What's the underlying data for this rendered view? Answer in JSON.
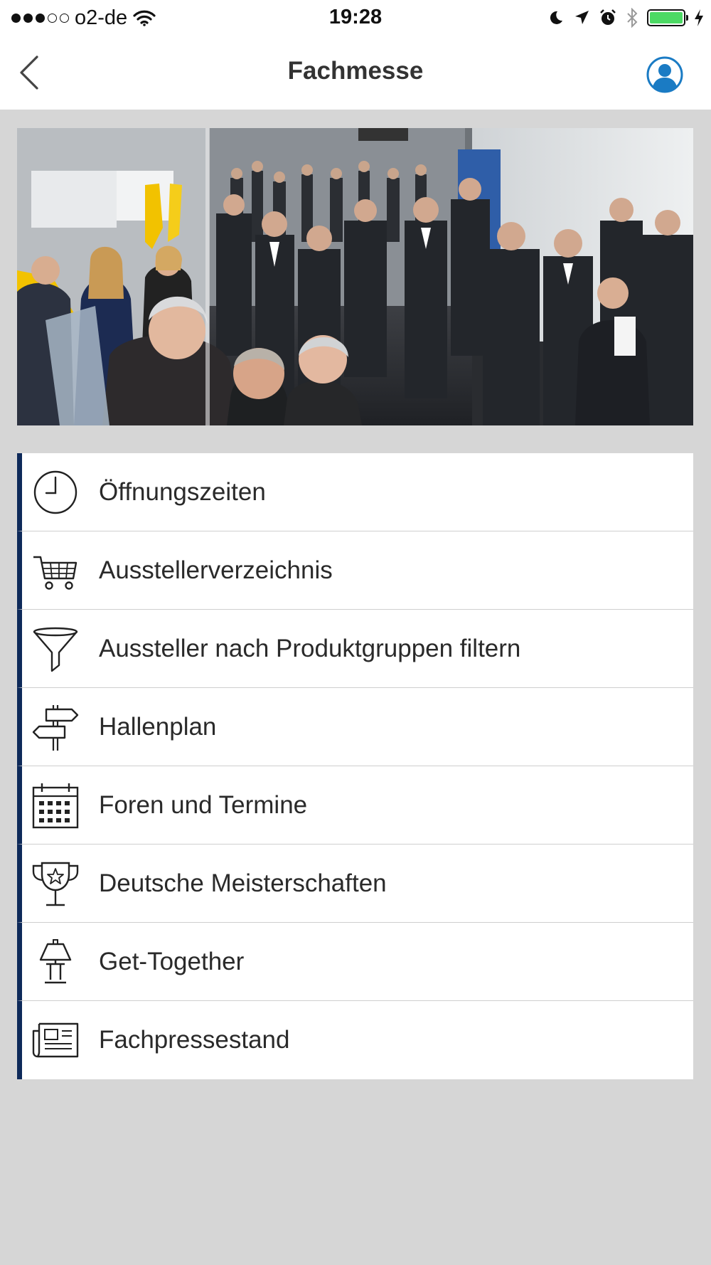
{
  "status_bar": {
    "carrier": "o2-de",
    "time": "19:28",
    "signal_dots_full": 3,
    "signal_dots_total": 5,
    "battery_level": 1.0
  },
  "nav": {
    "title": "Fachmesse",
    "back_icon": "chevron-left-icon",
    "profile_icon": "user-profile-icon"
  },
  "hero": {
    "image_alt_icon": "trade-fair-photo"
  },
  "menu": {
    "items": [
      {
        "label": "Öffnungszeiten",
        "icon": "clock-icon"
      },
      {
        "label": "Ausstellerverzeichnis",
        "icon": "cart-icon"
      },
      {
        "label": "Aussteller nach Produktgruppen filtern",
        "icon": "filter-funnel-icon"
      },
      {
        "label": "Hallenplan",
        "icon": "signpost-icon"
      },
      {
        "label": "Foren und Termine",
        "icon": "calendar-icon"
      },
      {
        "label": "Deutsche Meisterschaften",
        "icon": "trophy-icon"
      },
      {
        "label": "Get-Together",
        "icon": "lamp-table-icon"
      },
      {
        "label": "Fachpressestand",
        "icon": "newspaper-icon"
      }
    ]
  },
  "colors": {
    "accent": "#0e2a5a",
    "background": "#d6d6d6",
    "profile_blue": "#1a7bc4",
    "battery_green": "#4cd964"
  }
}
